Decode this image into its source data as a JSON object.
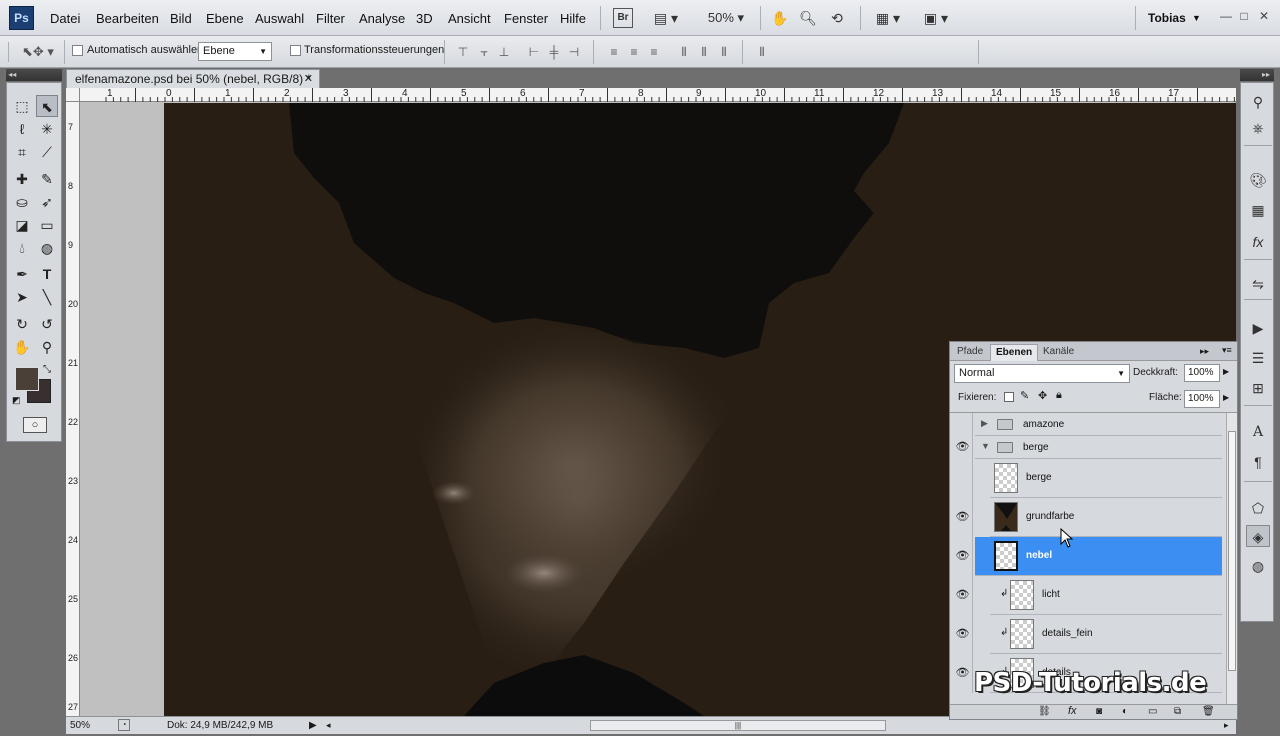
{
  "menubar": {
    "logo": "Ps",
    "items": [
      "Datei",
      "Bearbeiten",
      "Bild",
      "Ebene",
      "Auswahl",
      "Filter",
      "Analyse",
      "3D",
      "Ansicht",
      "Fenster",
      "Hilfe"
    ],
    "bridge": "Br",
    "zoom": "50%",
    "user": "Tobias"
  },
  "options": {
    "auto_select_label": "Automatisch auswählen:",
    "auto_select_value": "Ebene",
    "transform_label": "Transformationssteuerungen"
  },
  "document": {
    "tab_title": "elfenamazone.psd bei 50% (nebel, RGB/8) *",
    "ruler_top": [
      "1",
      "0",
      "1",
      "2",
      "3",
      "4",
      "5",
      "6",
      "7",
      "8",
      "9",
      "10",
      "11",
      "12",
      "13",
      "14",
      "15",
      "16",
      "17"
    ],
    "ruler_left": [
      "7",
      "8",
      "9",
      "20",
      "21",
      "22",
      "23",
      "24",
      "25",
      "26",
      "27"
    ]
  },
  "status": {
    "zoom": "50%",
    "doc_info": "Dok: 24,9 MB/242,9 MB"
  },
  "layers_panel": {
    "tabs": [
      "Pfade",
      "Ebenen",
      "Kanäle"
    ],
    "active_tab": "Ebenen",
    "blend_mode": "Normal",
    "opacity_label": "Deckkraft:",
    "opacity_value": "100%",
    "lock_label": "Fixieren:",
    "fill_label": "Fläche:",
    "fill_value": "100%",
    "layers": [
      {
        "name": "amazone",
        "kind": "group",
        "visible": false,
        "expanded": false
      },
      {
        "name": "berge",
        "kind": "group",
        "visible": true,
        "expanded": true
      },
      {
        "name": "berge",
        "kind": "layer",
        "visible": false
      },
      {
        "name": "grundfarbe",
        "kind": "layer",
        "visible": true
      },
      {
        "name": "nebel",
        "kind": "layer",
        "visible": true,
        "selected": true
      },
      {
        "name": "licht",
        "kind": "clipped",
        "visible": true
      },
      {
        "name": "details_fein",
        "kind": "clipped",
        "visible": true
      },
      {
        "name": "details",
        "kind": "clipped",
        "visible": true
      }
    ]
  },
  "watermark": "PSD-Tutorials.de",
  "colors": {
    "canvas": "#281e14",
    "selection": "#3b8ff2",
    "foreground_swatch": "#4a4038",
    "background_swatch": "#383030"
  }
}
